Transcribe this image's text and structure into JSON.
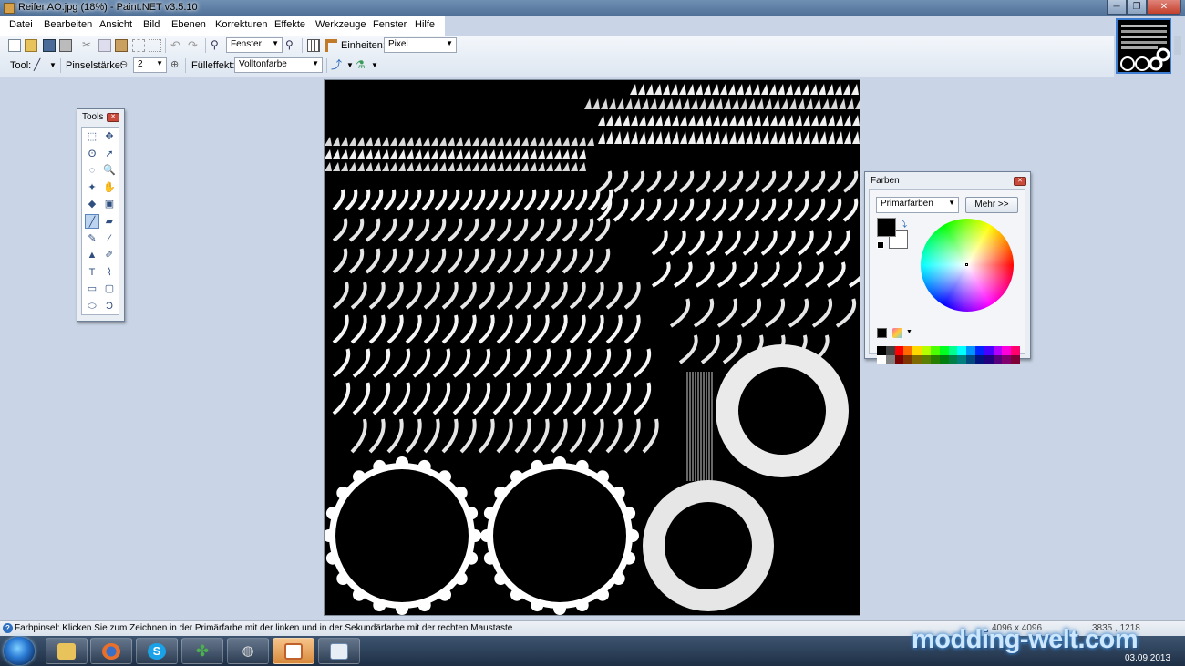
{
  "window": {
    "title": "ReifenAO.jpg (18%) - Paint.NET v3.5.10",
    "min_glyph": "─",
    "max_glyph": "❐",
    "close_glyph": "✕"
  },
  "menu": [
    "Datei",
    "Bearbeiten",
    "Ansicht",
    "Bild",
    "Ebenen",
    "Korrekturen",
    "Effekte",
    "Werkzeuge",
    "Fenster",
    "Hilfe"
  ],
  "toolbar": {
    "zoom_value": "Fenster",
    "units_label": "Einheiten:",
    "units_value": "Pixel",
    "tool_label": "Tool:",
    "brush_width_label": "Pinselstärke:",
    "brush_width_value": "2",
    "fill_label": "Fülleffekt:",
    "fill_value": "Volltonfarbe"
  },
  "tools_panel": {
    "title": "Tools",
    "tools": [
      {
        "name": "rectangle-select",
        "glyph": "⬚"
      },
      {
        "name": "move-selection",
        "glyph": "✥"
      },
      {
        "name": "lasso-select",
        "glyph": "ʘ"
      },
      {
        "name": "move-selected",
        "glyph": "➚"
      },
      {
        "name": "ellipse-select",
        "glyph": "◌"
      },
      {
        "name": "zoom",
        "glyph": "🔍"
      },
      {
        "name": "magic-wand",
        "glyph": "✦"
      },
      {
        "name": "pan",
        "glyph": "✋"
      },
      {
        "name": "paint-bucket",
        "glyph": "◆"
      },
      {
        "name": "gradient",
        "glyph": "▣"
      },
      {
        "name": "paintbrush",
        "glyph": "╱"
      },
      {
        "name": "eraser",
        "glyph": "▰"
      },
      {
        "name": "pencil",
        "glyph": "✎"
      },
      {
        "name": "color-picker",
        "glyph": "⁄"
      },
      {
        "name": "clone-stamp",
        "glyph": "▲"
      },
      {
        "name": "recolor",
        "glyph": "✐"
      },
      {
        "name": "text",
        "glyph": "T"
      },
      {
        "name": "line-curve",
        "glyph": "⌇"
      },
      {
        "name": "rectangle",
        "glyph": "▭"
      },
      {
        "name": "rounded-rectangle",
        "glyph": "▢"
      },
      {
        "name": "ellipse",
        "glyph": "⬭"
      },
      {
        "name": "freeform-shape",
        "glyph": "Ɔ"
      }
    ],
    "selected": "paintbrush"
  },
  "colors_panel": {
    "title": "Farben",
    "mode_value": "Primärfarben",
    "more_button": "Mehr >>",
    "primary_color": "#000000",
    "secondary_color": "#ffffff",
    "palette_top": [
      "#000000",
      "#404040",
      "#ff0000",
      "#ff6a00",
      "#ffd800",
      "#b6ff00",
      "#4cff00",
      "#00ff21",
      "#00ff90",
      "#00ffff",
      "#0094ff",
      "#0026ff",
      "#4800ff",
      "#b200ff",
      "#ff00dc",
      "#ff006e"
    ],
    "palette_bottom": [
      "#ffffff",
      "#808080",
      "#7f0000",
      "#7f3300",
      "#7f6a00",
      "#5b7f00",
      "#267f00",
      "#007f0e",
      "#007f46",
      "#007f7f",
      "#004a7f",
      "#00137f",
      "#21007f",
      "#57007f",
      "#7f006e",
      "#7f0037"
    ]
  },
  "status": {
    "hint": "Farbpinsel: Klicken Sie zum Zeichnen in der Primärfarbe mit der linken und in der Sekundärfarbe mit der rechten Maustaste",
    "image_size": "4096 x 4096",
    "cursor_pos": "3835 , 1218"
  },
  "taskbar": {
    "apps": [
      "explorer",
      "firefox",
      "skype",
      "clover",
      "app-5",
      "paint-net",
      "app-7"
    ],
    "active": "paint-net",
    "watermark": "modding-welt.com",
    "date": "03.09.2013"
  }
}
